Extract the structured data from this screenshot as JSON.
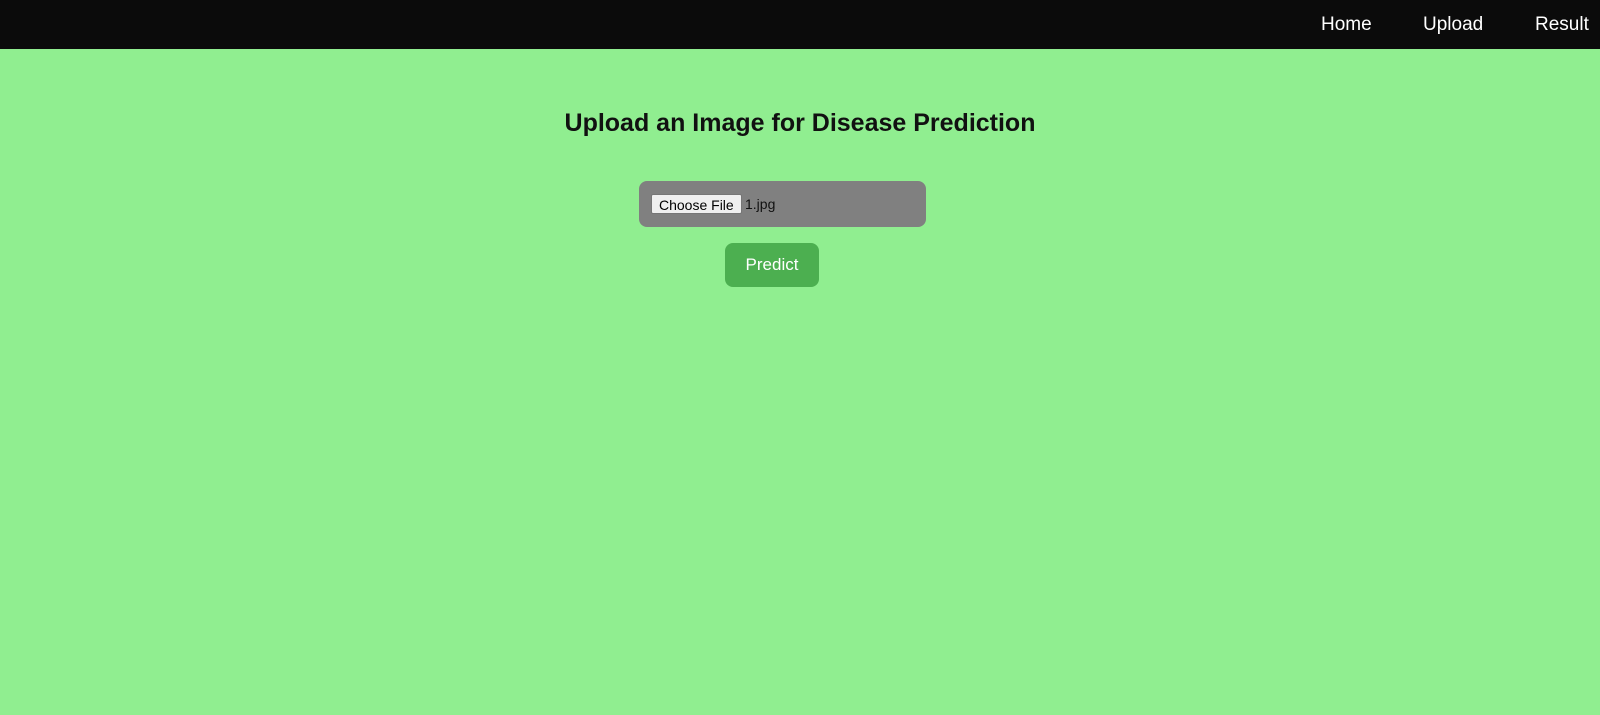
{
  "nav": {
    "items": [
      {
        "label": "Home"
      },
      {
        "label": "Upload"
      },
      {
        "label": "Result"
      }
    ]
  },
  "main": {
    "title": "Upload an Image for Disease Prediction",
    "file_input": {
      "button_label": "Choose File",
      "file_name": "1.jpg"
    },
    "predict_label": "Predict"
  },
  "colors": {
    "background": "#90ee90",
    "navbar": "#0b0b0b",
    "file_box": "#808080",
    "predict_button": "#4caf50"
  }
}
